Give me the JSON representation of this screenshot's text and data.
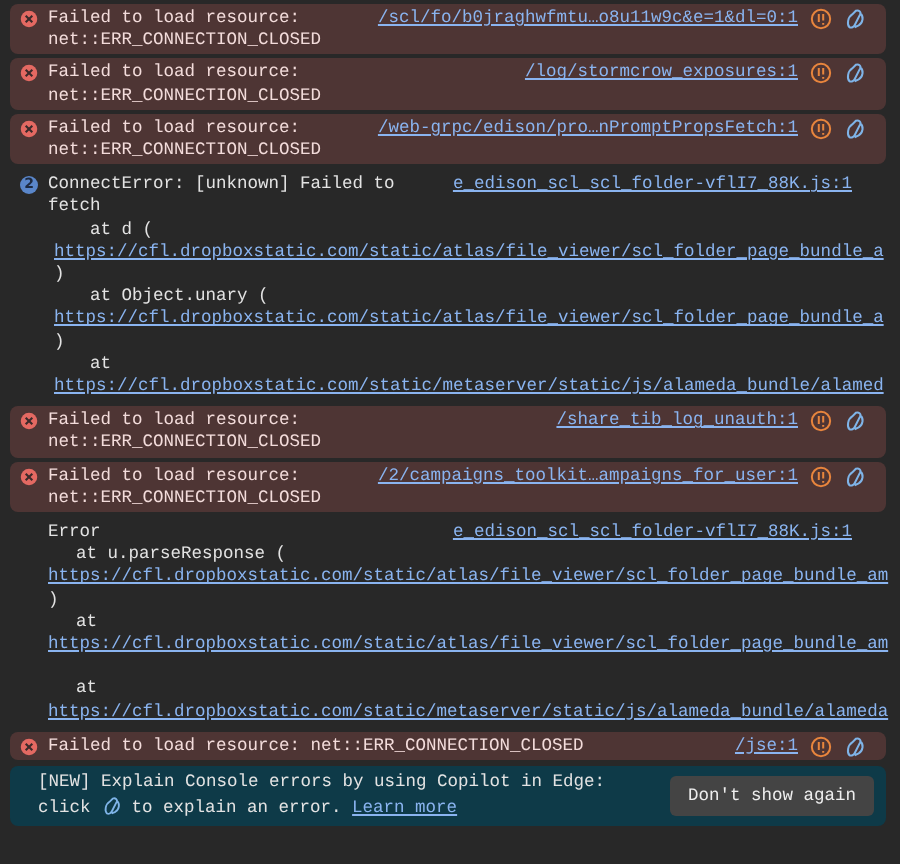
{
  "messages": [
    {
      "kind": "error",
      "message": "Failed to load resource: net::ERR_CONNECTION_CLOSED",
      "source": "/scl/fo/b0jraghwfmtu…o8u11w9c&e=1&dl=0:1"
    },
    {
      "kind": "error",
      "message": "Failed to load resource: net::ERR_CONNECTION_CLOSED",
      "source": "/log/stormcrow_exposures:1"
    },
    {
      "kind": "error",
      "message": "Failed to load resource: net::ERR_CONNECTION_CLOSED",
      "source": "/web-grpc/edison/pro…nPromptPropsFetch:1"
    },
    {
      "kind": "info",
      "repeat_count": "2",
      "message": "ConnectError: [unknown] Failed to fetch",
      "source": "e_edison_scl_scl_folder-vflI7_88K.js:1",
      "stack": [
        {
          "kind": "call",
          "text": "at d ("
        },
        {
          "kind": "link",
          "text": "https://cfl.dropboxstatic.com/static/atlas/file_viewer/scl_folder_page_bundle_a"
        },
        {
          "kind": "text",
          "text": ")"
        },
        {
          "kind": "call",
          "text": "at Object.unary ("
        },
        {
          "kind": "link",
          "text": "https://cfl.dropboxstatic.com/static/atlas/file_viewer/scl_folder_page_bundle_a"
        },
        {
          "kind": "text",
          "text": ")"
        },
        {
          "kind": "call",
          "text": "at"
        },
        {
          "kind": "link",
          "text": "https://cfl.dropboxstatic.com/static/metaserver/static/js/alameda_bundle/alamed"
        }
      ]
    },
    {
      "kind": "error",
      "message": "Failed to load resource: net::ERR_CONNECTION_CLOSED",
      "source": "/share_tib_log_unauth:1"
    },
    {
      "kind": "error",
      "message": "Failed to load resource: net::ERR_CONNECTION_CLOSED",
      "source": "/2/campaigns_toolkit…ampaigns_for_user:1"
    },
    {
      "kind": "log",
      "message": "Error",
      "source": "e_edison_scl_scl_folder-vflI7_88K.js:1",
      "stack": [
        {
          "kind": "call",
          "text": "at u.parseResponse ("
        },
        {
          "kind": "link",
          "text": "https://cfl.dropboxstatic.com/static/atlas/file_viewer/scl_folder_page_bundle_am"
        },
        {
          "kind": "text",
          "text": ")"
        },
        {
          "kind": "call",
          "text": "at"
        },
        {
          "kind": "link",
          "text": "https://cfl.dropboxstatic.com/static/atlas/file_viewer/scl_folder_page_bundle_am"
        },
        {
          "kind": "blank"
        },
        {
          "kind": "call",
          "text": "at"
        },
        {
          "kind": "link",
          "text": "https://cfl.dropboxstatic.com/static/metaserver/static/js/alameda_bundle/alameda"
        }
      ]
    },
    {
      "kind": "error",
      "message": "Failed to load resource: net::ERR_CONNECTION_CLOSED",
      "source": "/jse:1"
    }
  ],
  "banner": {
    "text_before": "[NEW] Explain Console errors by using Copilot in Edge: click",
    "text_after": "to explain an error.",
    "link": "Learn more",
    "button": "Don't show again"
  }
}
